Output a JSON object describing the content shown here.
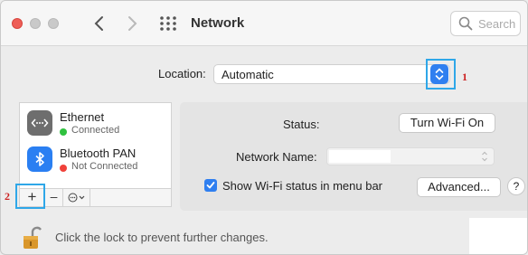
{
  "window": {
    "title": "Network",
    "search_placeholder": "Search"
  },
  "location": {
    "label": "Location:",
    "value": "Automatic"
  },
  "callouts": {
    "one": "1",
    "two": "2"
  },
  "services": [
    {
      "name": "Ethernet",
      "status": "Connected",
      "status_color": "#2fc13f",
      "icon": "ethernet-icon"
    },
    {
      "name": "Bluetooth PAN",
      "status": "Not Connected",
      "status_color": "#f0413a",
      "icon": "bluetooth-icon"
    }
  ],
  "toolbar": {
    "add_label": "+",
    "remove_label": "–"
  },
  "details": {
    "status_label": "Status:",
    "turn_wifi_button": "Turn Wi-Fi On",
    "network_name_label": "Network Name:",
    "network_name_value": "",
    "show_wifi_status_label": "Show Wi-Fi status in menu bar",
    "show_wifi_status_checked": true,
    "advanced_button": "Advanced...",
    "help_button": "?"
  },
  "lock": {
    "text": "Click the lock to prevent further changes."
  },
  "colors": {
    "accent": "#2f7ff0",
    "highlight": "#2fa7e8",
    "callout": "#cc2222"
  }
}
